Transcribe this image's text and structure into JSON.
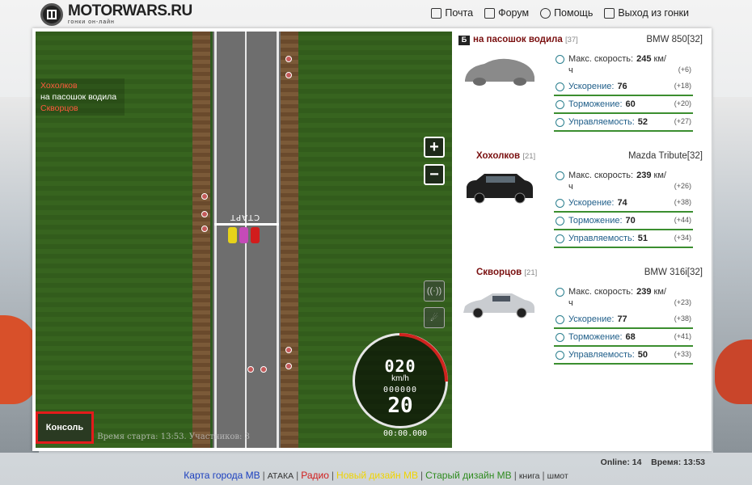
{
  "header": {
    "logo_title": "MOTORWARS.RU",
    "logo_subtitle": "гонки он-лайн",
    "nav": [
      {
        "label": "Почта",
        "icon": "mail-icon"
      },
      {
        "label": "Форум",
        "icon": "forum-icon"
      },
      {
        "label": "Помощь",
        "icon": "help-icon"
      },
      {
        "label": "Выход из гонки",
        "icon": "exit-icon"
      }
    ]
  },
  "game": {
    "start_label": "СТАРТ",
    "players": [
      {
        "name": "Хохолков",
        "color": "#ff5a3c"
      },
      {
        "name": "на пасошок водила",
        "color": "#ffffff"
      },
      {
        "name": "Скворцов",
        "color": "#ff5a3c"
      }
    ],
    "zoom_in": "+",
    "zoom_out": "−",
    "speedometer": {
      "speed": "020",
      "unit": "km/h",
      "odometer": "000000",
      "big_number": "20"
    },
    "timer": "00:00.000",
    "status_text": "сь! Время старта: 13:53. Участников: 3",
    "console_label": "Консоль"
  },
  "competitors": [
    {
      "name": "на пасошок водила",
      "level": "[37]",
      "car": "BMW 850[32]",
      "stats": {
        "max_speed_label": "Макс. скорость:",
        "max_speed_value": "245",
        "max_speed_unit_a": "км/",
        "max_speed_unit_b": "ч",
        "max_speed_bonus": "(+6)",
        "accel_label": "Ускорение:",
        "accel_value": "76",
        "accel_bonus": "(+18)",
        "brake_label": "Торможение:",
        "brake_value": "60",
        "brake_bonus": "(+20)",
        "handling_label": "Управляемость:",
        "handling_value": "52",
        "handling_bonus": "(+27)"
      }
    },
    {
      "name": "Хохолков",
      "level": "[21]",
      "car": "Mazda Tribute[32]",
      "stats": {
        "max_speed_label": "Макс. скорость:",
        "max_speed_value": "239",
        "max_speed_unit_a": "км/",
        "max_speed_unit_b": "ч",
        "max_speed_bonus": "(+26)",
        "accel_label": "Ускорение:",
        "accel_value": "74",
        "accel_bonus": "(+38)",
        "brake_label": "Торможение:",
        "brake_value": "70",
        "brake_bonus": "(+44)",
        "handling_label": "Управляемость:",
        "handling_value": "51",
        "handling_bonus": "(+34)"
      }
    },
    {
      "name": "Скворцов",
      "level": "[21]",
      "car": "BMW 316i[32]",
      "stats": {
        "max_speed_label": "Макс. скорость:",
        "max_speed_value": "239",
        "max_speed_unit_a": "км/",
        "max_speed_unit_b": "ч",
        "max_speed_bonus": "(+23)",
        "accel_label": "Ускорение:",
        "accel_value": "77",
        "accel_bonus": "(+38)",
        "brake_label": "Торможение:",
        "brake_value": "68",
        "brake_bonus": "(+41)",
        "handling_label": "Управляемость:",
        "handling_value": "50",
        "handling_bonus": "(+33)"
      }
    }
  ],
  "status_bar": {
    "online_label": "Online:",
    "online_value": "14",
    "time_label": "Время:",
    "time_value": "13:53"
  },
  "footer": {
    "links": [
      {
        "label": "Карта города МВ",
        "color": "#1b3fbf"
      },
      {
        "label": "АТАКА",
        "color": "#333333"
      },
      {
        "label": "Радио",
        "color": "#d11c1c"
      },
      {
        "label": "Новый дизайн МВ",
        "color": "#f0d400"
      },
      {
        "label": "Старый дизайн МВ",
        "color": "#2e8b1e"
      },
      {
        "label": "книга",
        "color": "#333333"
      },
      {
        "label": "шмот",
        "color": "#333333"
      }
    ]
  }
}
